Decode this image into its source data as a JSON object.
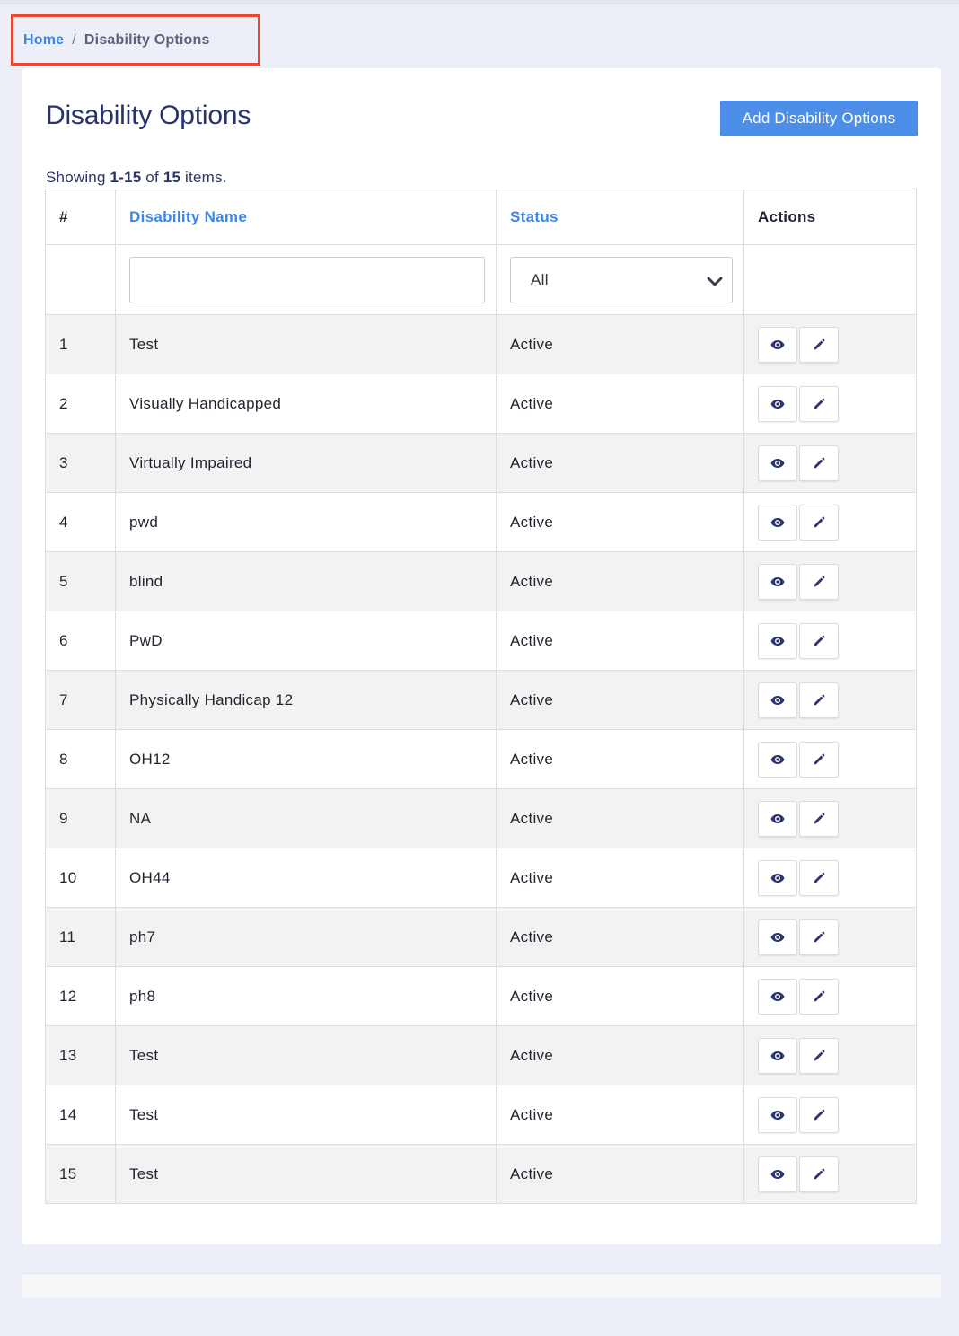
{
  "breadcrumb": {
    "home": "Home",
    "separator": "/",
    "current": "Disability Options"
  },
  "page": {
    "title": "Disability Options",
    "add_button": "Add Disability Options"
  },
  "summary": {
    "prefix": "Showing ",
    "range": "1-15",
    "middle": " of ",
    "total": "15",
    "suffix": " items."
  },
  "table": {
    "headers": {
      "index": "#",
      "name": "Disability Name",
      "status": "Status",
      "actions": "Actions"
    },
    "filters": {
      "name_value": "",
      "status_selected": "All"
    },
    "rows": [
      {
        "index": "1",
        "name": "Test",
        "status": "Active"
      },
      {
        "index": "2",
        "name": "Visually Handicapped",
        "status": "Active"
      },
      {
        "index": "3",
        "name": "Virtually Impaired",
        "status": "Active"
      },
      {
        "index": "4",
        "name": "pwd",
        "status": "Active"
      },
      {
        "index": "5",
        "name": "blind",
        "status": "Active"
      },
      {
        "index": "6",
        "name": "PwD",
        "status": "Active"
      },
      {
        "index": "7",
        "name": "Physically Handicap 12",
        "status": "Active"
      },
      {
        "index": "8",
        "name": "OH12",
        "status": "Active"
      },
      {
        "index": "9",
        "name": "NA",
        "status": "Active"
      },
      {
        "index": "10",
        "name": "OH44",
        "status": "Active"
      },
      {
        "index": "11",
        "name": "ph7",
        "status": "Active"
      },
      {
        "index": "12",
        "name": "ph8",
        "status": "Active"
      },
      {
        "index": "13",
        "name": "Test",
        "status": "Active"
      },
      {
        "index": "14",
        "name": "Test",
        "status": "Active"
      },
      {
        "index": "15",
        "name": "Test",
        "status": "Active"
      }
    ],
    "row_actions": [
      "eye-icon",
      "pencil-icon"
    ]
  },
  "colors": {
    "accent": "#4d8ee9",
    "link": "#3f86e3",
    "title": "#28336b",
    "highlight_box": "#e8462f",
    "icon": "#2b3570"
  }
}
